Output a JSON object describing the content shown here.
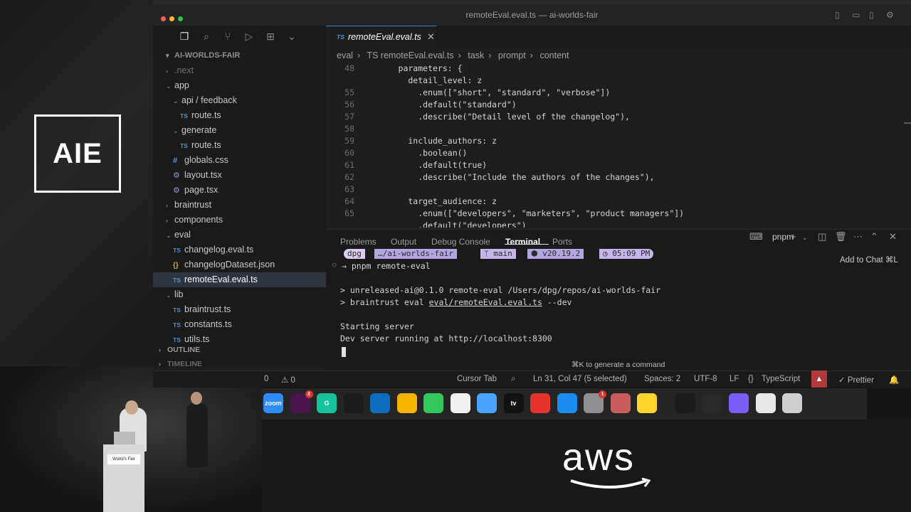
{
  "window": {
    "title": "remoteEval.eval.ts — ai-worlds-fair",
    "traffic_colors": [
      "#ff5f57",
      "#febc2e",
      "#28c840"
    ]
  },
  "branding": {
    "conference_logo": "AIE",
    "sponsor_logo": "aws",
    "podium_sign": "World's Fair"
  },
  "sidebar": {
    "header": "AI-WORLDS-FAIR",
    "tree": [
      {
        "label": ".next",
        "kind": "folder",
        "expanded": false,
        "depth": 1,
        "dim": true
      },
      {
        "label": "app",
        "kind": "folder",
        "expanded": true,
        "depth": 1
      },
      {
        "label": "api / feedback",
        "kind": "folder",
        "expanded": true,
        "depth": 2
      },
      {
        "label": "route.ts",
        "kind": "ts",
        "depth": 3
      },
      {
        "label": "generate",
        "kind": "folder",
        "expanded": true,
        "depth": 2
      },
      {
        "label": "route.ts",
        "kind": "ts",
        "depth": 3
      },
      {
        "label": "globals.css",
        "kind": "css",
        "depth": 2
      },
      {
        "label": "layout.tsx",
        "kind": "gear",
        "depth": 2
      },
      {
        "label": "page.tsx",
        "kind": "gear",
        "depth": 2
      },
      {
        "label": "braintrust",
        "kind": "folder",
        "expanded": false,
        "depth": 1
      },
      {
        "label": "components",
        "kind": "folder",
        "expanded": false,
        "depth": 1
      },
      {
        "label": "eval",
        "kind": "folder",
        "expanded": true,
        "depth": 1
      },
      {
        "label": "changelog.eval.ts",
        "kind": "ts",
        "depth": 2
      },
      {
        "label": "changelogDataset.json",
        "kind": "json",
        "depth": 2
      },
      {
        "label": "remoteEval.eval.ts",
        "kind": "ts",
        "depth": 2,
        "selected": true
      },
      {
        "label": "lib",
        "kind": "folder",
        "expanded": true,
        "depth": 1
      },
      {
        "label": "braintrust.ts",
        "kind": "ts",
        "depth": 2
      },
      {
        "label": "constants.ts",
        "kind": "ts",
        "depth": 2
      },
      {
        "label": "utils.ts",
        "kind": "ts",
        "depth": 2
      }
    ],
    "outline_label": "OUTLINE",
    "timeline_label": "TIMELINE",
    "ts_badge": "TS",
    "css_badge": "#",
    "json_badge": "{}"
  },
  "editor": {
    "tab_label": "remoteEval.eval.ts",
    "breadcrumb": [
      "eval",
      "TS remoteEval.eval.ts",
      "task",
      "prompt",
      "content"
    ],
    "lines": [
      {
        "n": "48",
        "text": "      parameters: {"
      },
      {
        "n": "",
        "text": "        detail_level: z"
      },
      {
        "n": "55",
        "text": "          .enum([\"short\", \"standard\", \"verbose\"])"
      },
      {
        "n": "56",
        "text": "          .default(\"standard\")"
      },
      {
        "n": "57",
        "text": "          .describe(\"Detail level of the changelog\"),"
      },
      {
        "n": "58",
        "text": ""
      },
      {
        "n": "59",
        "text": "        include_authors: z"
      },
      {
        "n": "60",
        "text": "          .boolean()"
      },
      {
        "n": "61",
        "text": "          .default(true)"
      },
      {
        "n": "62",
        "text": "          .describe(\"Include the authors of the changes\"),"
      },
      {
        "n": "63",
        "text": ""
      },
      {
        "n": "64",
        "text": "        target_audience: z"
      },
      {
        "n": "65",
        "text": "          .enum([\"developers\", \"marketers\", \"product managers\"])"
      },
      {
        "n": "",
        "text": "          .default(\"developers\")"
      }
    ]
  },
  "panel": {
    "tabs": [
      "Problems",
      "Output",
      "Debug Console",
      "Terminal",
      "Ports"
    ],
    "active_tab": "Terminal",
    "shell_label": "pnpm",
    "add_to_chat": "Add to Chat ⌘L",
    "prompt": {
      "user": "dpg",
      "dir": "…/ai-worlds-fair",
      "branch": "main",
      "node": "v20.19.2",
      "time": "05:09 PM"
    },
    "terminal_lines": [
      "→ pnpm remote-eval",
      "",
      "> unreleased-ai@0.1.0 remote-eval /Users/dpg/repos/ai-worlds-fair",
      "> braintrust eval eval/remoteEval.eval.ts --dev",
      "",
      "Starting server",
      "Dev server running at http://localhost:8300"
    ],
    "hint": "⌘K to generate a command"
  },
  "statusbar": {
    "problems": "0",
    "warnings": "0",
    "cursor_tab": "Cursor Tab",
    "position": "Ln 31, Col 47 (5 selected)",
    "spaces": "Spaces: 2",
    "encoding": "UTF-8",
    "eol": "LF",
    "language": "TypeScript",
    "formatter": "Prettier"
  },
  "dock": {
    "apps": [
      {
        "name": "zoom",
        "label": "zoom",
        "color": "#2d8cff"
      },
      {
        "name": "slack",
        "label": "",
        "color": "#4a154b",
        "badge": "2"
      },
      {
        "name": "grammarly",
        "label": "G",
        "color": "#15c39a"
      },
      {
        "name": "cursor",
        "label": "",
        "color": "#1b1b1b"
      },
      {
        "name": "outlook",
        "label": "",
        "color": "#0f6cbd"
      },
      {
        "name": "photos",
        "label": "",
        "color": "#f4b400"
      },
      {
        "name": "facetime",
        "label": "",
        "color": "#34c759"
      },
      {
        "name": "reminders",
        "label": "",
        "color": "#f0f0f0"
      },
      {
        "name": "freeform",
        "label": "",
        "color": "#4aa3ff"
      },
      {
        "name": "tv",
        "label": "tv",
        "color": "#111111"
      },
      {
        "name": "news",
        "label": "",
        "color": "#e5322d"
      },
      {
        "name": "appstore",
        "label": "",
        "color": "#1c8cf0"
      },
      {
        "name": "settings",
        "label": "",
        "color": "#8e8e93",
        "badge": "1"
      },
      {
        "name": "ruler",
        "label": "",
        "color": "#c65c5c"
      },
      {
        "name": "notes",
        "label": "",
        "color": "#ffd52e"
      },
      {
        "name": "cursor2",
        "label": "",
        "color": "#1b1b1b"
      },
      {
        "name": "git-tool",
        "label": "",
        "color": "#2a2a2a"
      },
      {
        "name": "perplexity",
        "label": "",
        "color": "#7c5cff"
      },
      {
        "name": "document",
        "label": "",
        "color": "#e8e8e8"
      },
      {
        "name": "trash",
        "label": "",
        "color": "#cfcfcf"
      }
    ]
  }
}
